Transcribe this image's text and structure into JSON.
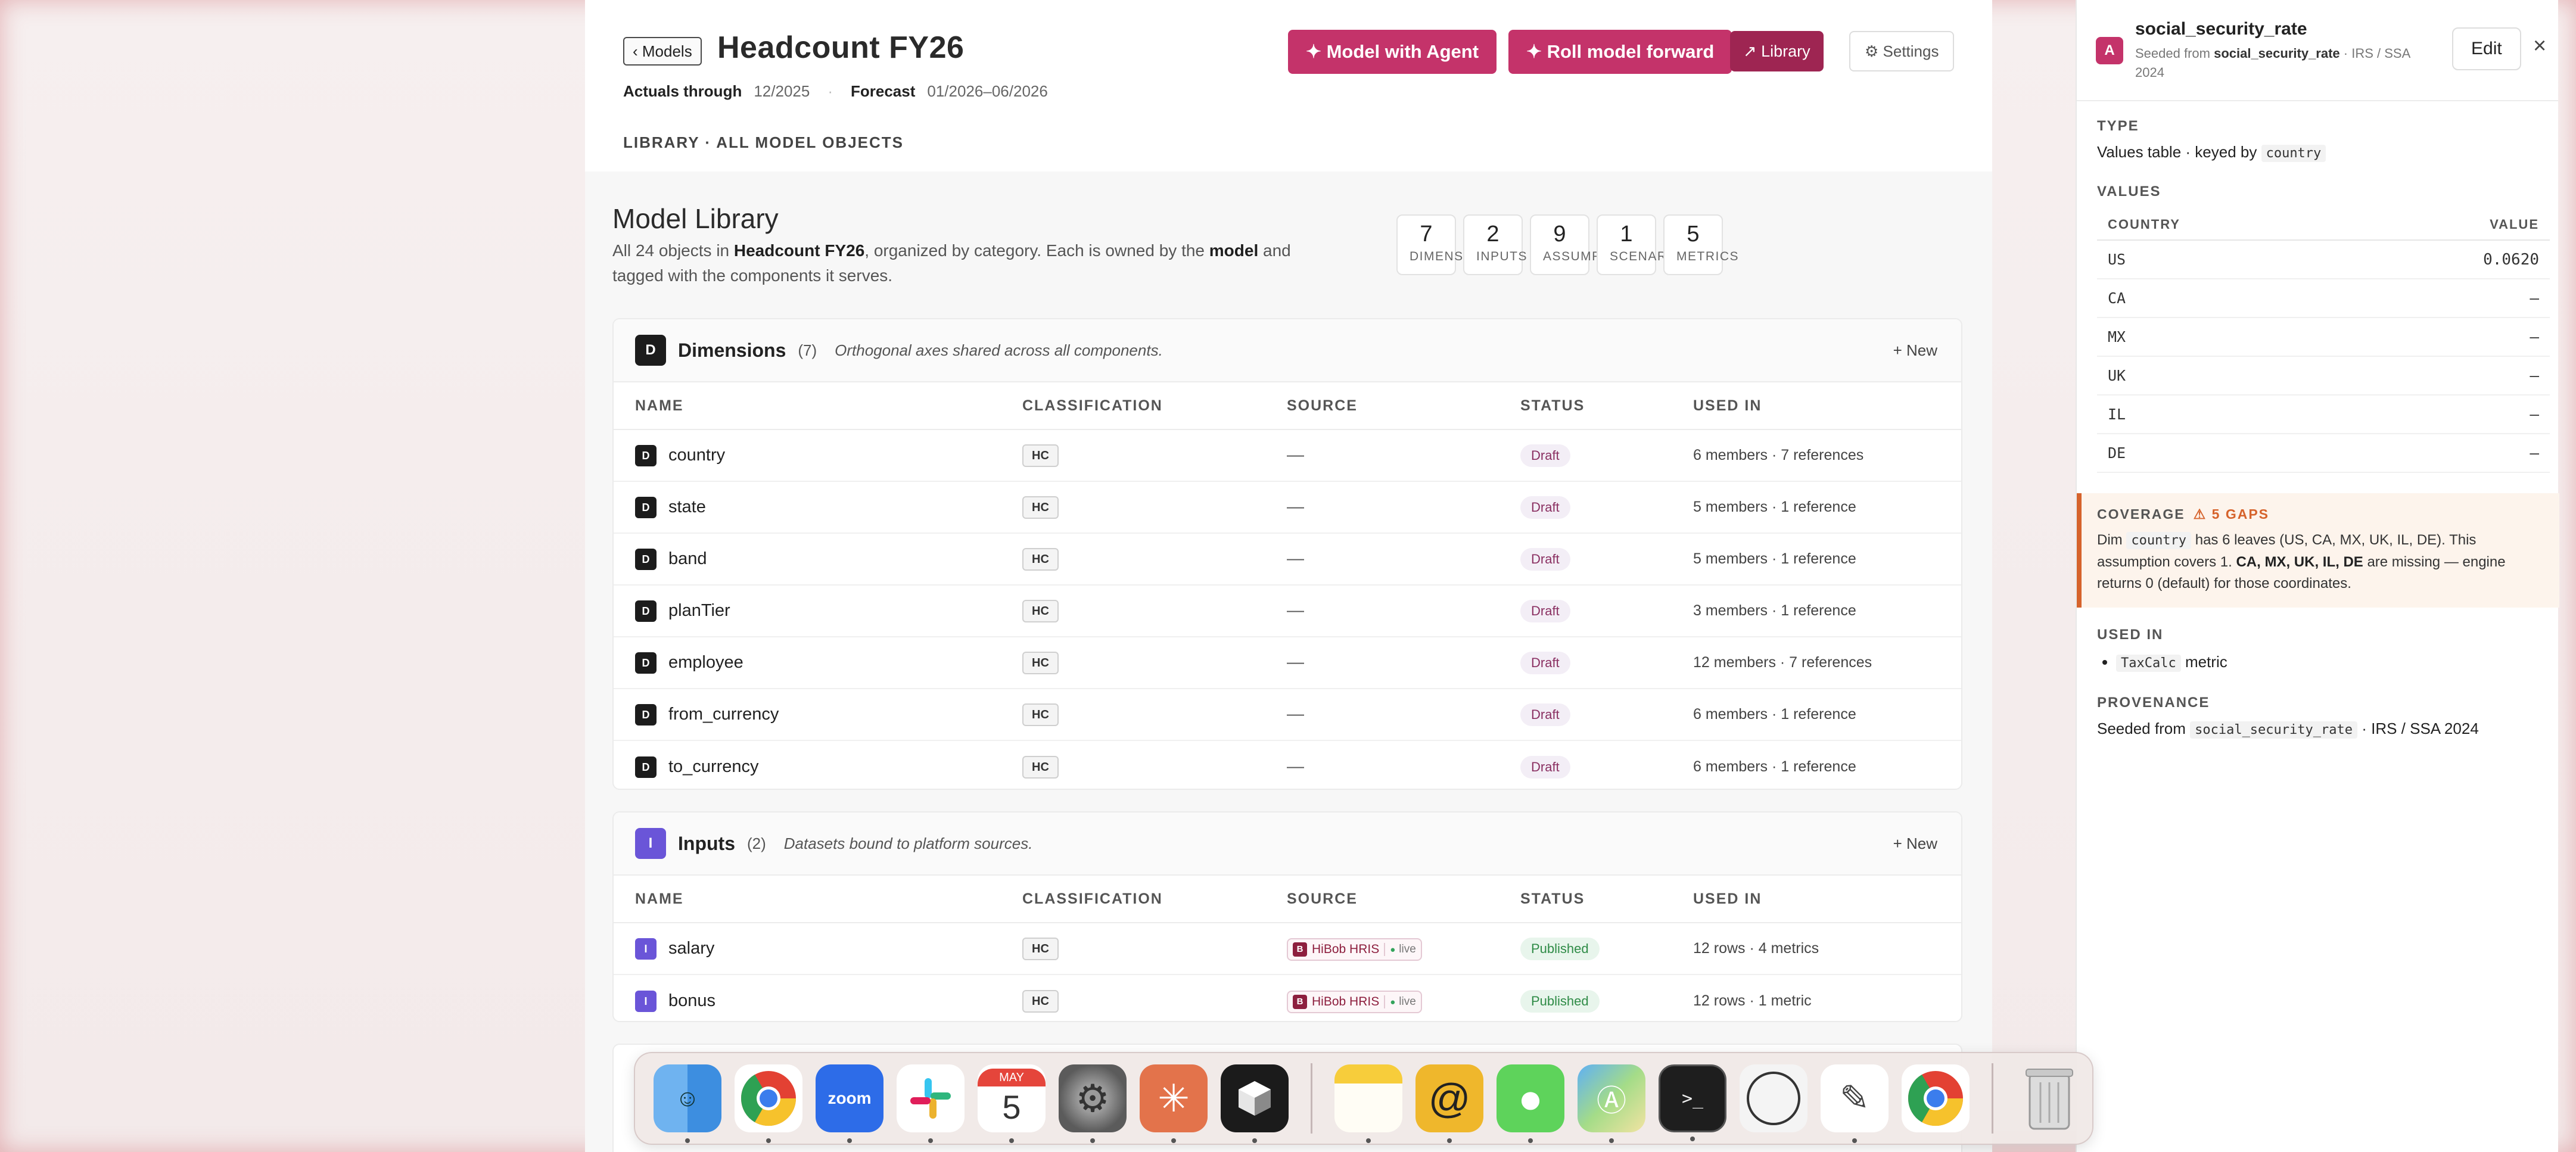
{
  "header": {
    "back_label": "‹ Models",
    "title": "Headcount FY26",
    "actuals_label": "Actuals through",
    "actuals_value": "12/2025",
    "forecast_label": "Forecast",
    "forecast_value": "01/2026–06/2026",
    "breadcrumb": "LIBRARY · ALL MODEL OBJECTS",
    "buttons": {
      "agent": "✦ Model with Agent",
      "roll": "✦ Roll model forward",
      "library": "↗ Library",
      "settings": "⚙ Settings"
    }
  },
  "library": {
    "title": "Model Library",
    "desc_prefix": "All 24 objects in ",
    "desc_model": "Headcount FY26",
    "desc_mid": ", organized by category. Each is owned by the ",
    "desc_model_word": "model",
    "desc_suffix": " and tagged with the components it serves.",
    "stats": [
      {
        "num": "7",
        "label": "DIMENSIONS"
      },
      {
        "num": "2",
        "label": "INPUTS"
      },
      {
        "num": "9",
        "label": "ASSUMPTIONS"
      },
      {
        "num": "1",
        "label": "SCENARIOS"
      },
      {
        "num": "5",
        "label": "METRICS"
      }
    ],
    "columns": [
      "NAME",
      "CLASSIFICATION",
      "SOURCE",
      "STATUS",
      "USED IN"
    ],
    "dimensions": {
      "badge": "D",
      "title": "Dimensions",
      "count": "(7)",
      "hint": "Orthogonal axes shared across all components.",
      "new_label": "+ New",
      "rows": [
        {
          "name": "country",
          "class": "HC",
          "source": "—",
          "status": "Draft",
          "used": "6 members · 7 references"
        },
        {
          "name": "state",
          "class": "HC",
          "source": "—",
          "status": "Draft",
          "used": "5 members · 1 reference"
        },
        {
          "name": "band",
          "class": "HC",
          "source": "—",
          "status": "Draft",
          "used": "5 members · 1 reference"
        },
        {
          "name": "planTier",
          "class": "HC",
          "source": "—",
          "status": "Draft",
          "used": "3 members · 1 reference"
        },
        {
          "name": "employee",
          "class": "HC",
          "source": "—",
          "status": "Draft",
          "used": "12 members · 7 references"
        },
        {
          "name": "from_currency",
          "class": "HC",
          "source": "—",
          "status": "Draft",
          "used": "6 members · 1 reference"
        },
        {
          "name": "to_currency",
          "class": "HC",
          "source": "—",
          "status": "Draft",
          "used": "6 members · 1 reference"
        }
      ]
    },
    "inputs": {
      "badge": "I",
      "title": "Inputs",
      "count": "(2)",
      "hint": "Datasets bound to platform sources.",
      "new_label": "+ New",
      "rows": [
        {
          "name": "salary",
          "class": "HC",
          "source_badge": "B",
          "source_name": "HiBob HRIS",
          "source_live": "live",
          "status": "Published",
          "used": "12 rows · 4 metrics"
        },
        {
          "name": "bonus",
          "class": "HC",
          "source_badge": "B",
          "source_name": "HiBob HRIS",
          "source_live": "live",
          "status": "Published",
          "used": "12 rows · 1 metric"
        }
      ]
    }
  },
  "panel": {
    "badge": "A",
    "title": "social_security_rate",
    "sub_prefix": "Seeded from ",
    "sub_name": "social_security_rate",
    "sub_suffix": " · IRS / SSA 2024",
    "edit_label": "Edit",
    "close_label": "×",
    "type_label": "TYPE",
    "type_text": "Values table · keyed by ",
    "type_key": "country",
    "values_label": "VALUES",
    "col_country": "COUNTRY",
    "col_value": "VALUE",
    "values": [
      {
        "country": "US",
        "value": "0.0620"
      },
      {
        "country": "CA",
        "value": "—"
      },
      {
        "country": "MX",
        "value": "—"
      },
      {
        "country": "UK",
        "value": "—"
      },
      {
        "country": "IL",
        "value": "—"
      },
      {
        "country": "DE",
        "value": "—"
      }
    ],
    "coverage_label": "COVERAGE",
    "coverage_gaps": "⚠ 5 GAPS",
    "coverage_dim": "Dim ",
    "coverage_key": "country",
    "coverage_text1": " has 6 leaves (US, CA, MX, UK, IL, DE). This assumption covers 1. ",
    "coverage_missing": "CA, MX, UK, IL, DE",
    "coverage_text2": " are missing — engine returns 0 (default) for those coordinates.",
    "used_label": "USED IN",
    "used_key": "TaxCalc",
    "used_suffix": " metric",
    "prov_label": "PROVENANCE",
    "prov_prefix": "Seeded from ",
    "prov_key": "social_security_rate",
    "prov_suffix": " · IRS / SSA 2024"
  },
  "dock": {
    "calendar_month": "MAY",
    "calendar_day": "5",
    "zoom_label": "zoom",
    "items": [
      "finder-icon",
      "chrome-icon",
      "zoom-icon",
      "slack-icon",
      "calendar-icon",
      "system-settings-icon",
      "claude-icon",
      "cursor-icon",
      "notes-icon",
      "spiral-app-icon",
      "messages-icon",
      "maps-icon",
      "terminal-icon",
      "circle-app-icon",
      "textedit-icon",
      "chrome-app-icon",
      "trash-icon"
    ]
  }
}
